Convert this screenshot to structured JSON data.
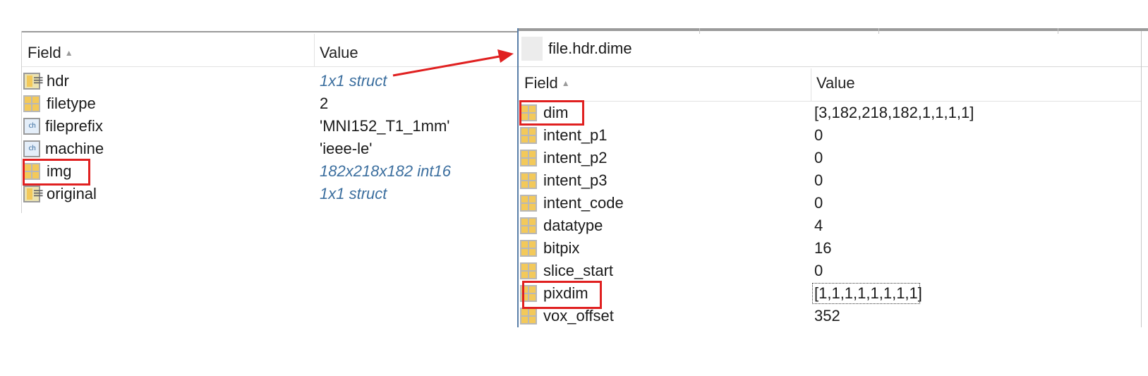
{
  "left_table": {
    "headers": {
      "field": "Field",
      "value": "Value"
    },
    "rows": [
      {
        "name": "hdr",
        "value": "1x1 struct",
        "icon": "struct-icon",
        "link": true
      },
      {
        "name": "filetype",
        "value": "2",
        "icon": "grid-icon",
        "link": false
      },
      {
        "name": "fileprefix",
        "value": "'MNI152_T1_1mm'",
        "icon": "char-icon",
        "link": false
      },
      {
        "name": "machine",
        "value": "'ieee-le'",
        "icon": "char-icon",
        "link": false
      },
      {
        "name": "img",
        "value": "182x218x182 int16",
        "icon": "grid-icon",
        "link": true
      },
      {
        "name": "original",
        "value": "1x1 struct",
        "icon": "struct-icon",
        "link": true
      }
    ]
  },
  "right_table": {
    "path": "file.hdr.dime",
    "headers": {
      "field": "Field",
      "value": "Value"
    },
    "rows": [
      {
        "name": "dim",
        "value": "[3,182,218,182,1,1,1,1]",
        "icon": "grid-icon"
      },
      {
        "name": "intent_p1",
        "value": "0",
        "icon": "grid-icon"
      },
      {
        "name": "intent_p2",
        "value": "0",
        "icon": "grid-icon"
      },
      {
        "name": "intent_p3",
        "value": "0",
        "icon": "grid-icon"
      },
      {
        "name": "intent_code",
        "value": "0",
        "icon": "grid-icon"
      },
      {
        "name": "datatype",
        "value": "4",
        "icon": "grid-icon"
      },
      {
        "name": "bitpix",
        "value": "16",
        "icon": "grid-icon"
      },
      {
        "name": "slice_start",
        "value": "0",
        "icon": "grid-icon"
      },
      {
        "name": "pixdim",
        "value": "[1,1,1,1,1,1,1,1]",
        "icon": "grid-icon"
      },
      {
        "name": "vox_offset",
        "value": "352",
        "icon": "grid-icon"
      }
    ]
  },
  "annotations": {
    "highlight_color": "#e02020",
    "link_color": "#3c6f9f",
    "highlighted_rows": [
      "img",
      "dim",
      "pixdim"
    ]
  }
}
